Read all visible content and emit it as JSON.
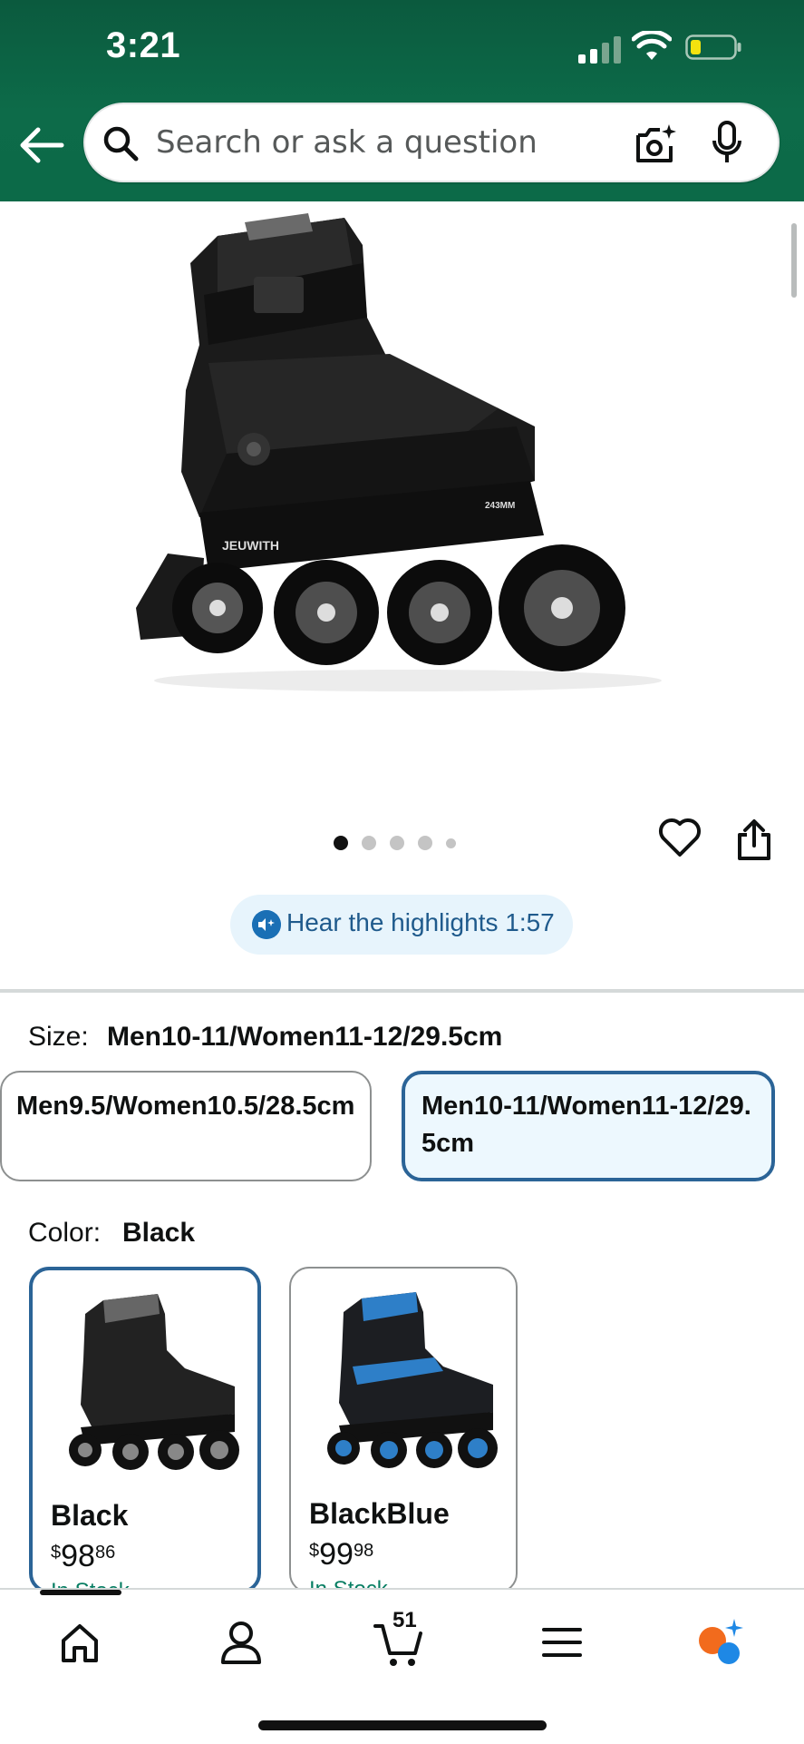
{
  "status_bar": {
    "time": "3:21"
  },
  "search": {
    "placeholder": "Search or ask a question"
  },
  "product": {
    "image_alt": "JEUWITH black inline skate",
    "brand_on_image": "JEUWITH",
    "frame_marking": "243MM",
    "gallery": {
      "dot_count": 5,
      "active_index": 0
    }
  },
  "highlights": {
    "label": "Hear the highlights 1:57"
  },
  "size": {
    "label": "Size:",
    "selected": "Men10-11/Women11-12/29.5cm",
    "options": [
      {
        "label": "Men9.5/Women10.5/28.5cm",
        "selected": false
      },
      {
        "label": "Men10-11/Women11-12/29.5cm",
        "selected": true
      }
    ]
  },
  "color": {
    "label": "Color:",
    "selected": "Black",
    "options": [
      {
        "name": "Black",
        "price_symbol": "$",
        "price_whole": "98",
        "price_fraction": "86",
        "stock": "In Stock",
        "selected": true,
        "accent": "#3a3a3a"
      },
      {
        "name": "BlackBlue",
        "price_symbol": "$",
        "price_whole": "99",
        "price_fraction": "98",
        "stock": "In Stock",
        "selected": false,
        "accent": "#2e7fc8"
      }
    ]
  },
  "bottom_nav": {
    "items": [
      "home-icon",
      "account-icon",
      "cart-icon",
      "menu-icon",
      "rufus-icon"
    ],
    "cart_count": "51"
  },
  "colors": {
    "header_green": "#0c6a48",
    "selected_border": "#2b6497",
    "selected_bg": "#edf8fe",
    "highlights_bg": "#e7f4fc",
    "stock_green": "#067d62"
  }
}
